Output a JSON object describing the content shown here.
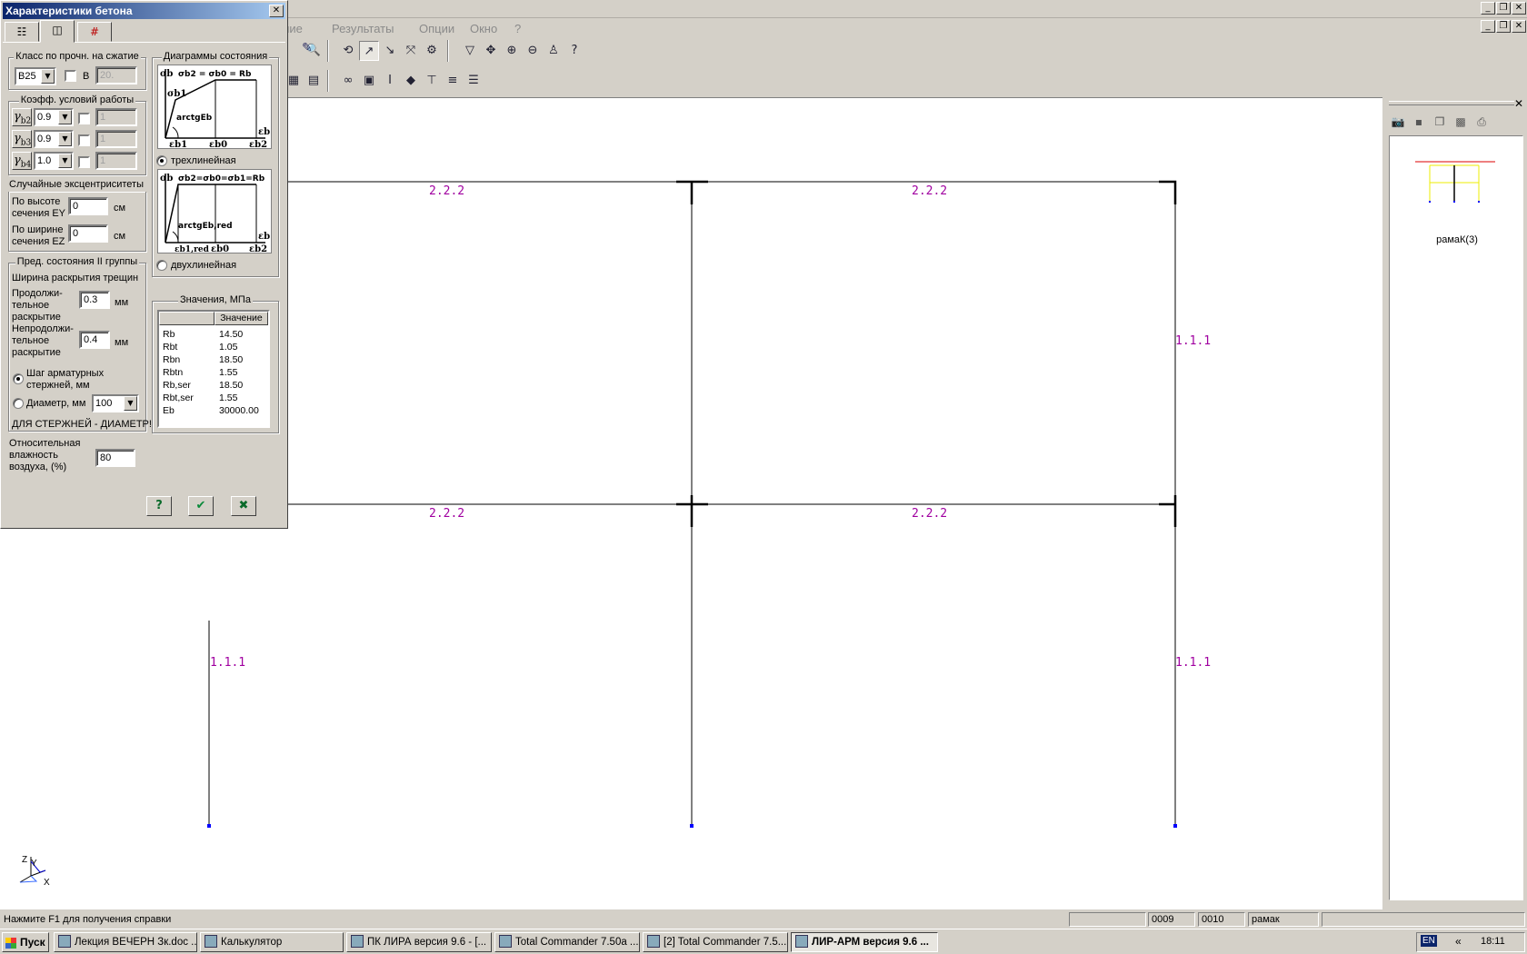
{
  "menu": [
    "ание",
    "Результаты",
    "Опции",
    "Окно",
    "?"
  ],
  "dialog": {
    "title": "Характеристики бетона",
    "class_group": {
      "legend": "Класс по прочн. на сжатие",
      "class_value": "B25",
      "b_label": "B",
      "b_value": "20."
    },
    "coef_group": {
      "legend": "Коэфф. условий работы",
      "rows": [
        {
          "sym": "γ",
          "sub": "b2",
          "value": "0.9",
          "field": "1"
        },
        {
          "sym": "γ",
          "sub": "b3",
          "value": "0.9",
          "field": "1"
        },
        {
          "sym": "γ",
          "sub": "b4",
          "value": "1.0",
          "field": "1"
        }
      ]
    },
    "ecc": {
      "legend": "Случайные эксцентриситеты",
      "ey_label_1": "По высоте",
      "ey_label_2": "сечения EY",
      "ey_value": "0",
      "ez_label_1": "По ширине",
      "ez_label_2": "сечения EZ",
      "ez_value": "0",
      "unit": "см"
    },
    "limit": {
      "legend": "Пред. состояния II группы",
      "crack_label": "Ширина раскрытия трещин",
      "long_1": "Продолжи-",
      "long_2": "тельное",
      "long_3": "раскрытие",
      "long_value": "0.3",
      "short_1": "Непродолжи-",
      "short_2": "тельное",
      "short_3": "раскрытие",
      "short_value": "0.4",
      "unit": "мм",
      "step_1": "Шаг арматурных",
      "step_2": "стержней, мм",
      "diam_label": "Диаметр, мм",
      "diam_value": "100",
      "note": "ДЛЯ СТЕРЖНЕЙ - ДИАМЕТР!"
    },
    "humidity": {
      "label_1": "Относительная",
      "label_2": "влажность",
      "label_3": "воздуха, (%)",
      "value": "80"
    },
    "diagrams": {
      "legend": "Диаграммы состояния",
      "d1_eq": "σb2 = σb0 = Rb",
      "d1_sb": "σb",
      "d1_sb1": "σb1",
      "d1_arc": "arctgEb",
      "d1_eb1": "εb1",
      "d1_eb0": "εb0",
      "d1_eb2": "εb2",
      "d1_eb": "εb",
      "tri_label": "трехлинейная",
      "d2_eq": "σb2=σb0=σb1=Rb",
      "d2_sb": "σb",
      "d2_arc": "arctgEb,red",
      "d2_eb1": "εb1,red",
      "d2_eb0": "εb0",
      "d2_eb2": "εb2",
      "d2_eb": "εb",
      "bi_label": "двухлинейная"
    },
    "values": {
      "legend": "Значения, МПа",
      "col_header": "Значение",
      "rows": [
        {
          "name": "Rb",
          "value": "14.50"
        },
        {
          "name": "Rbt",
          "value": "1.05"
        },
        {
          "name": "Rbn",
          "value": "18.50"
        },
        {
          "name": "Rbtn",
          "value": "1.55"
        },
        {
          "name": "Rb,ser",
          "value": "18.50"
        },
        {
          "name": "Rbt,ser",
          "value": "1.55"
        },
        {
          "name": "Eb",
          "value": "30000.00"
        }
      ]
    }
  },
  "canvas": {
    "beam_label": "2.2.2",
    "column_label": "1.1.1",
    "axes": {
      "z": "Z",
      "y": "Y",
      "x": "X"
    }
  },
  "right_panel": {
    "thumb_label": "рамаК(3)"
  },
  "status": {
    "help": "Нажмите F1 для получения справки",
    "cell1": "0009",
    "cell2": "0010",
    "cell3": "рамак"
  },
  "taskbar": {
    "start": "Пуск",
    "tasks": [
      "Лекция ВЕЧЕРН Зк.doc ...",
      "Калькулятор",
      "ПК ЛИРА  версия 9.6 - [...",
      "Total Commander 7.50a ...",
      "[2] Total Commander 7.5...",
      "ЛИР-АРМ версия 9.6  ..."
    ],
    "lang": "EN",
    "clock": "18:11",
    "chevron": "«"
  }
}
